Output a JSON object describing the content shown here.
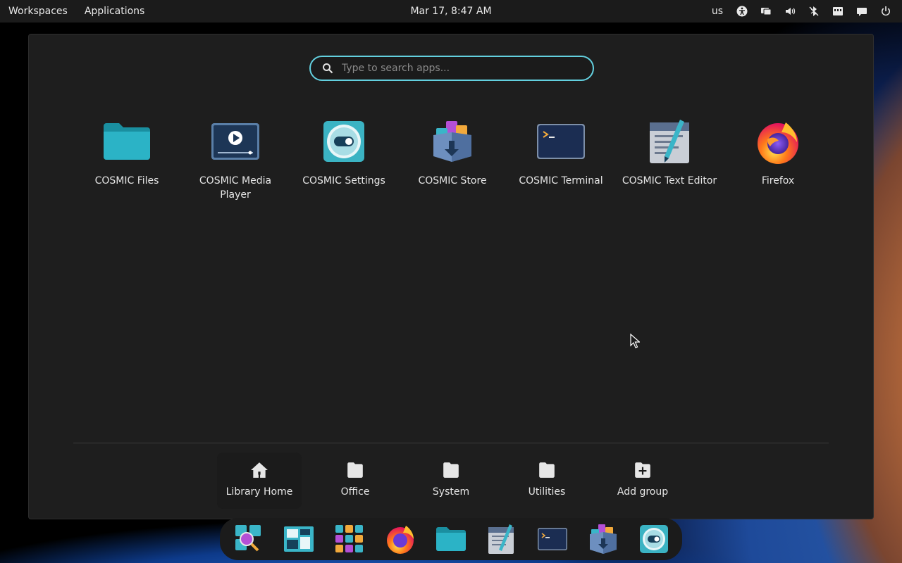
{
  "panel": {
    "workspaces_label": "Workspaces",
    "applications_label": "Applications",
    "clock": "Mar 17, 8:47 AM",
    "keyboard_layout": "us"
  },
  "search": {
    "placeholder": "Type to search apps...",
    "value": ""
  },
  "apps": [
    {
      "label": "COSMIC Files",
      "icon": "folder-icon"
    },
    {
      "label": "COSMIC Media Player",
      "icon": "media-player-icon"
    },
    {
      "label": "COSMIC Settings",
      "icon": "settings-toggle-icon"
    },
    {
      "label": "COSMIC Store",
      "icon": "store-box-icon"
    },
    {
      "label": "COSMIC Terminal",
      "icon": "terminal-icon"
    },
    {
      "label": "COSMIC Text Editor",
      "icon": "text-editor-icon"
    },
    {
      "label": "Firefox",
      "icon": "firefox-icon"
    }
  ],
  "groups": [
    {
      "label": "Library Home",
      "icon": "home-icon"
    },
    {
      "label": "Office",
      "icon": "folder-icon"
    },
    {
      "label": "System",
      "icon": "folder-icon"
    },
    {
      "label": "Utilities",
      "icon": "folder-icon"
    },
    {
      "label": "Add group",
      "icon": "folder-add-icon"
    }
  ],
  "dock": [
    "launcher-icon",
    "workspaces-icon",
    "app-library-icon",
    "firefox-icon",
    "files-icon",
    "text-editor-icon",
    "terminal-icon",
    "store-icon",
    "settings-icon"
  ],
  "colors": {
    "accent": "#63d0df",
    "surface": "#1e1e1e",
    "panel": "#1b1b1b"
  }
}
